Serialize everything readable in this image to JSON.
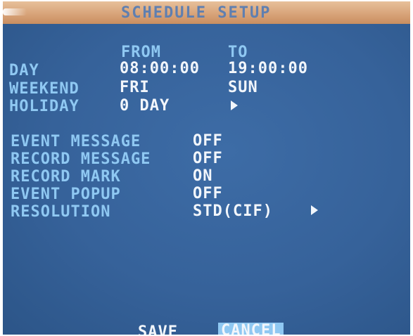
{
  "title": "SCHEDULE SETUP",
  "schedule": {
    "from_header": "FROM",
    "to_header": "TO",
    "rows": [
      {
        "label": "DAY",
        "from": "08:00:00",
        "to": "19:00:00"
      },
      {
        "label": "WEEKEND",
        "from": "FRI",
        "to": "SUN"
      },
      {
        "label": "HOLIDAY",
        "from": "0 DAY",
        "to": ""
      }
    ]
  },
  "settings": [
    {
      "label": "EVENT MESSAGE",
      "value": "OFF"
    },
    {
      "label": "RECORD MESSAGE",
      "value": "OFF"
    },
    {
      "label": "RECORD MARK",
      "value": "ON"
    },
    {
      "label": "EVENT POPUP",
      "value": "OFF"
    },
    {
      "label": "RESOLUTION",
      "value": "STD(CIF)"
    }
  ],
  "buttons": {
    "save": "SAVE",
    "cancel": "CANCEL"
  },
  "colors": {
    "screen_bg": "#36629a",
    "title_bar": "#d8a47a",
    "label_text": "#8fc8f2",
    "value_text": "#f2f6fb",
    "cancel_highlight": "#8fc8f2"
  },
  "icons": {
    "holiday_arrow": "right-triangle-icon",
    "resolution_arrow": "right-triangle-icon"
  }
}
